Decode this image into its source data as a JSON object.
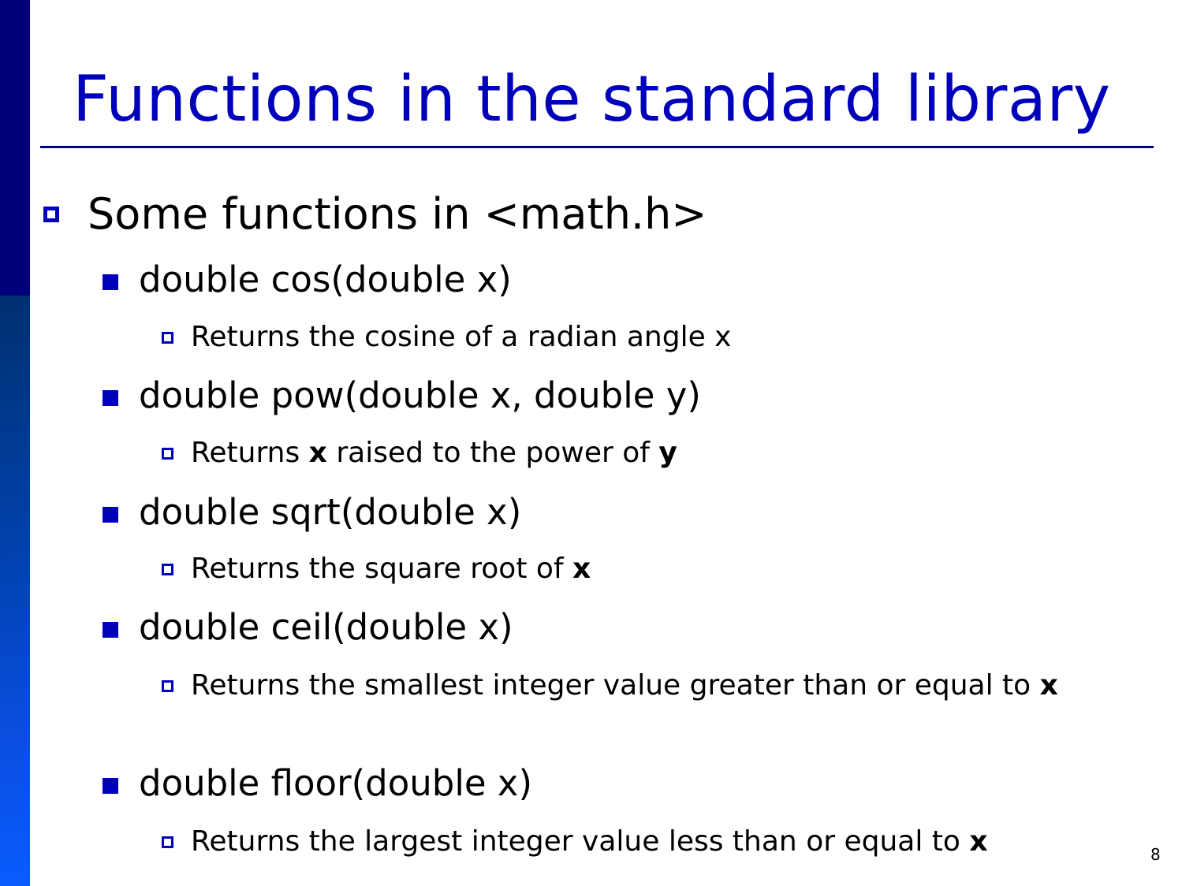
{
  "slide": {
    "title": "Functions in the standard library",
    "page_number": "8",
    "colors": {
      "accent": "#0000bb",
      "sidebar_top": "#00007a",
      "sidebar_gradient_start": "#003070",
      "sidebar_gradient_end": "#0a5cff",
      "rule": "#000080"
    }
  },
  "bullet": {
    "text": "Some functions in <math.h>",
    "items": [
      {
        "signature": "double cos(double x)",
        "desc_pre": "Returns the cosine of a radian angle x",
        "desc_bold1": "",
        "desc_mid": "",
        "desc_bold2": ""
      },
      {
        "signature": "double pow(double x, double y)",
        "desc_pre": "Returns ",
        "desc_bold1": "x",
        "desc_mid": " raised to the power of ",
        "desc_bold2": "y"
      },
      {
        "signature": "double sqrt(double x)",
        "desc_pre": "Returns the square root of ",
        "desc_bold1": "x",
        "desc_mid": "",
        "desc_bold2": ""
      },
      {
        "signature": "double ceil(double x)",
        "desc_pre": "Returns the smallest integer value greater than or equal to ",
        "desc_bold1": "x",
        "desc_mid": "",
        "desc_bold2": ""
      },
      {
        "signature": "double floor(double x)",
        "desc_pre": "Returns the largest integer value less than or equal to ",
        "desc_bold1": "x",
        "desc_mid": "",
        "desc_bold2": ""
      }
    ]
  }
}
